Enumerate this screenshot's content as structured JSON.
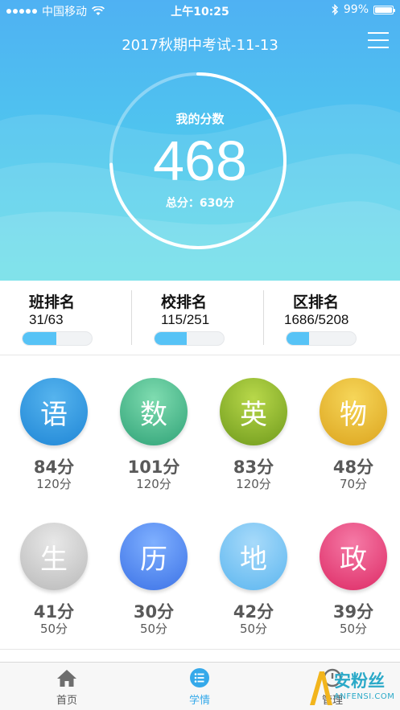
{
  "status_bar": {
    "carrier": "中国移动",
    "time": "上午10:25",
    "battery_percent": "99%",
    "battery_level": 0.99,
    "signal_bars": 5
  },
  "header": {
    "title": "2017秋期中考试-11-13",
    "menu_icon": "hamburger-menu-icon"
  },
  "score": {
    "label": "我的分数",
    "value": "468",
    "total": "总分：630分",
    "fraction": 0.743
  },
  "rankings": [
    {
      "title": "班排名",
      "value": "31/63",
      "fraction": 0.49
    },
    {
      "title": "校排名",
      "value": "115/251",
      "fraction": 0.46
    },
    {
      "title": "区排名",
      "value": "1686/5208",
      "fraction": 0.32
    }
  ],
  "subjects": [
    {
      "name": "语",
      "score": "84分",
      "full": "120分",
      "color_top": "#56b4ee",
      "color_bottom": "#1f86d6"
    },
    {
      "name": "数",
      "score": "101分",
      "full": "120分",
      "color_top": "#7fdcb0",
      "color_bottom": "#2fa277"
    },
    {
      "name": "英",
      "score": "83分",
      "full": "120分",
      "color_top": "#b8d84a",
      "color_bottom": "#6f9a1c"
    },
    {
      "name": "物",
      "score": "48分",
      "full": "70分",
      "color_top": "#f6d659",
      "color_bottom": "#dca41e"
    },
    {
      "name": "生",
      "score": "41分",
      "full": "50分",
      "color_top": "#e8e8e8",
      "color_bottom": "#b9b9b9"
    },
    {
      "name": "历",
      "score": "30分",
      "full": "50分",
      "color_top": "#7fb0ff",
      "color_bottom": "#3c72e6"
    },
    {
      "name": "地",
      "score": "42分",
      "full": "50分",
      "color_top": "#a7dafa",
      "color_bottom": "#5cb6ef"
    },
    {
      "name": "政",
      "score": "39分",
      "full": "50分",
      "color_top": "#f57aa6",
      "color_bottom": "#dd2a65"
    }
  ],
  "tabs": [
    {
      "label": "首页",
      "icon": "home-icon",
      "active": false
    },
    {
      "label": "学情",
      "icon": "list-icon",
      "active": true
    },
    {
      "label": "管理",
      "icon": "manage-icon",
      "active": false
    }
  ],
  "watermark": {
    "text": "安粉丝",
    "sub": "ANFENSI.COM"
  },
  "colors": {
    "accent": "#35a9ea",
    "hero_top": "#4fb1f3",
    "hero_bottom": "#4fd9e4",
    "rank_fill": "#57c3f6"
  }
}
